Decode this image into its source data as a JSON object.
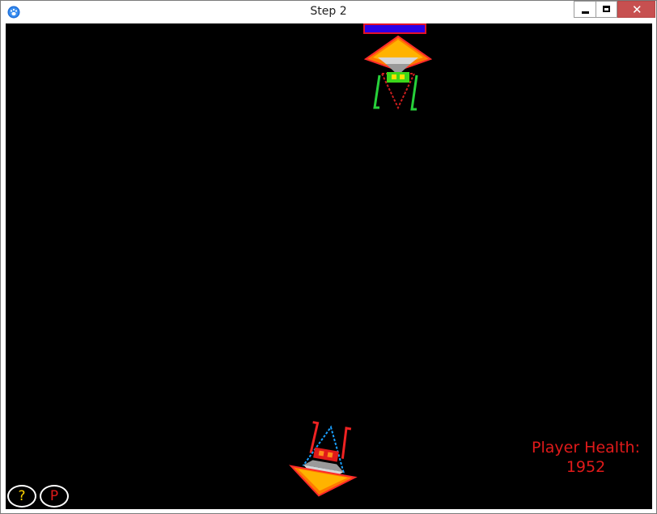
{
  "window": {
    "title": "Step 2",
    "close_glyph": "✕"
  },
  "icons": {
    "app": "paw-icon",
    "minimize": "minimize-icon",
    "maximize": "maximize-icon",
    "close": "close-icon"
  },
  "game": {
    "background_color": "#000000",
    "enemy": {
      "health_fraction": 1.0,
      "bar_color": "#2b00e6",
      "bar_border_color": "#e2122a",
      "accent_color": "#27d13a"
    },
    "player": {
      "accent_color": "#e01a1a"
    },
    "hud": {
      "health_label": "Player Health:",
      "health_value": "1952",
      "help_label": "?",
      "pause_label": "P",
      "help_color": "#ffd400",
      "pause_color": "#e01a1a"
    }
  }
}
